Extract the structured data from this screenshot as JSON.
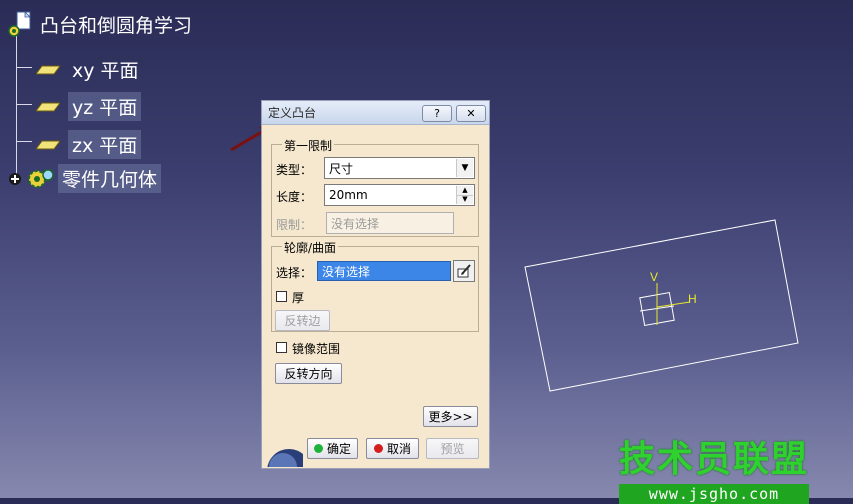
{
  "tree": {
    "root": "凸台和倒圆角学习",
    "planes": [
      "xy 平面",
      "yz 平面",
      "zx 平面"
    ],
    "body": "零件几何体"
  },
  "dialog": {
    "title": "定义凸台",
    "help_button": "?",
    "close_button": "✕",
    "first_limit": {
      "legend": "第一限制",
      "type_label": "类型：",
      "type_value": "尺寸",
      "length_label": "长度：",
      "length_value": "20mm",
      "limit_label": "限制：",
      "limit_value": "没有选择"
    },
    "profile": {
      "legend": "轮廓/曲面",
      "select_label": "选择：",
      "select_value": "没有选择",
      "thick_label": "厚",
      "reverse_side_button": "反转边"
    },
    "mirror_label": "镜像范围",
    "reverse_direction_button": "反转方向",
    "more_button": "更多>>",
    "ok_button": "确定",
    "cancel_button": "取消",
    "preview_button": "预览"
  },
  "sketch": {
    "v_label": "V",
    "h_label": "H"
  },
  "watermark": {
    "title": "技术员联盟",
    "url": "www.jsgho.com"
  }
}
